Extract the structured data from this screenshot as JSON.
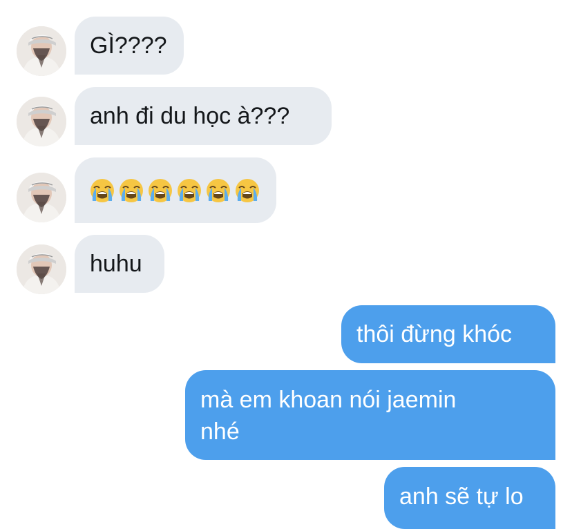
{
  "messages": [
    {
      "side": "incoming",
      "text": "GÌ????"
    },
    {
      "side": "incoming",
      "text": "anh đi du học à???"
    },
    {
      "side": "incoming",
      "emoji": "loudly-crying-face",
      "count": 6
    },
    {
      "side": "incoming",
      "text": "huhu"
    },
    {
      "side": "outgoing",
      "text": "thôi đừng khóc"
    },
    {
      "side": "outgoing",
      "text_line1": "mà em khoan nói jaemin",
      "text_line2": "nhé"
    },
    {
      "side": "outgoing",
      "text": "anh sẽ tự lo"
    }
  ],
  "colors": {
    "incoming_bubble": "#e7ebf0",
    "outgoing_bubble": "#4d9fec",
    "incoming_text": "#14171a",
    "outgoing_text": "#ffffff"
  }
}
